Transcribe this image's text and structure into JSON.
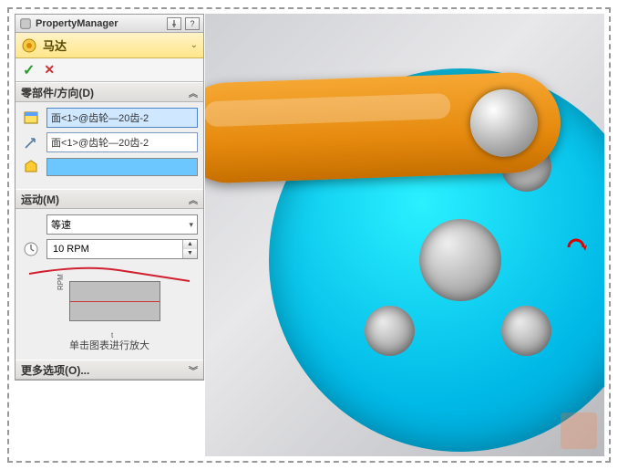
{
  "panel": {
    "title": "PropertyManager",
    "feature_name": "马达",
    "sections": {
      "component": {
        "header": "零部件/方向(D)",
        "face_field": "面<1>@齿轮—20齿-2",
        "direction_field": "面<1>@齿轮—20齿-2"
      },
      "motion": {
        "header": "运动(M)",
        "type_selected": "等速",
        "speed_value": "10 RPM",
        "graph_ylabel": "RPM",
        "graph_xlabel": "t",
        "graph_hint": "单击图表进行放大"
      },
      "more": {
        "header": "更多选项(O)..."
      }
    }
  },
  "icons": {
    "motor": "motor-icon",
    "ok": "✓",
    "cancel": "✕",
    "face": "face-icon",
    "direction": "direction-icon",
    "color": "color-icon",
    "clock": "clock-icon",
    "pin": "pin-icon",
    "help": "?",
    "spacer": "—"
  },
  "colors": {
    "swatch": "#6cc6ff"
  }
}
